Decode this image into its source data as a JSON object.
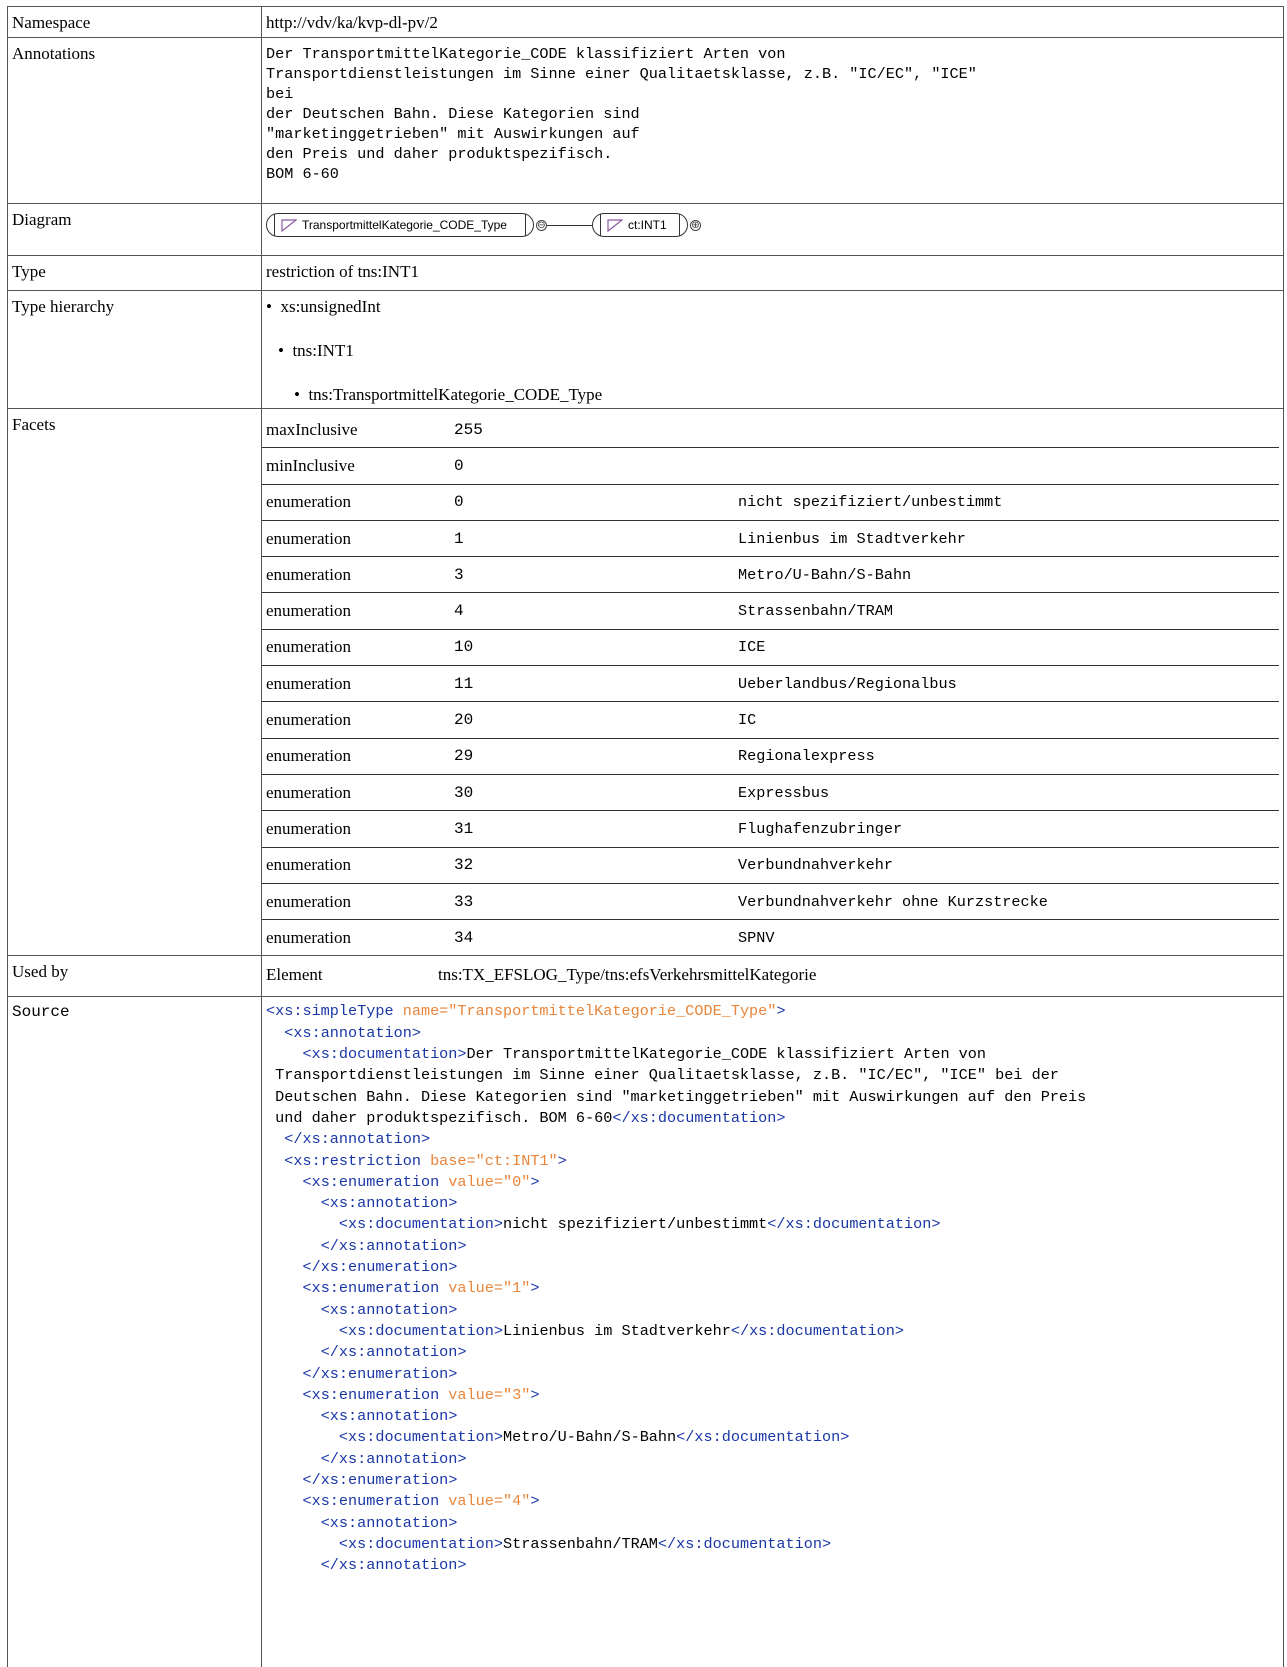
{
  "namespace": {
    "label": "Namespace",
    "value": "http://vdv/ka/kvp-dl-pv/2"
  },
  "annotations": {
    "label": "Annotations",
    "text": "Der TransportmittelKategorie_CODE klassifiziert Arten von\nTransportdienstleistungen im Sinne einer Qualitaetsklasse, z.B. \"IC/EC\", \"ICE\"\nbei\nder Deutschen Bahn. Diese Kategorien sind\n\"marketinggetrieben\" mit Auswirkungen auf\nden Preis und daher produktspezifisch.\nBOM 6-60"
  },
  "diagram": {
    "label": "Diagram",
    "node1": "TransportmittelKategorie_CODE_Type",
    "node2": "ct:INT1",
    "collapse_symbol": "⊖",
    "expand_symbol": "⊕"
  },
  "type": {
    "label": "Type",
    "value": "restriction of tns:INT1"
  },
  "type_hierarchy": {
    "label": "Type hierarchy",
    "bullet": "•",
    "items": [
      "xs:unsignedInt",
      "tns:INT1",
      "tns:TransportmittelKategorie_CODE_Type"
    ]
  },
  "facets": {
    "label": "Facets",
    "rows": [
      {
        "name": "maxInclusive",
        "value": "255",
        "doc": ""
      },
      {
        "name": "minInclusive",
        "value": "0",
        "doc": ""
      },
      {
        "name": "enumeration",
        "value": "0",
        "doc": "nicht spezifiziert/unbestimmt"
      },
      {
        "name": "enumeration",
        "value": "1",
        "doc": "Linienbus im Stadtverkehr"
      },
      {
        "name": "enumeration",
        "value": "3",
        "doc": "Metro/U-Bahn/S-Bahn"
      },
      {
        "name": "enumeration",
        "value": "4",
        "doc": "Strassenbahn/TRAM"
      },
      {
        "name": "enumeration",
        "value": "10",
        "doc": "ICE"
      },
      {
        "name": "enumeration",
        "value": "11",
        "doc": "Ueberlandbus/Regionalbus"
      },
      {
        "name": "enumeration",
        "value": "20",
        "doc": "IC"
      },
      {
        "name": "enumeration",
        "value": "29",
        "doc": "Regionalexpress"
      },
      {
        "name": "enumeration",
        "value": "30",
        "doc": "Expressbus"
      },
      {
        "name": "enumeration",
        "value": "31",
        "doc": "Flughafenzubringer"
      },
      {
        "name": "enumeration",
        "value": "32",
        "doc": "Verbundnahverkehr"
      },
      {
        "name": "enumeration",
        "value": "33",
        "doc": "Verbundnahverkehr ohne Kurzstrecke"
      },
      {
        "name": "enumeration",
        "value": "34",
        "doc": "SPNV"
      }
    ]
  },
  "used_by": {
    "label": "Used by",
    "kind": "Element",
    "value": "tns:TX_EFSLOG_Type/tns:efsVerkehrsmittelKategorie"
  },
  "source": {
    "label": "Source",
    "colors": {
      "tag": "#1a37a6",
      "attribute": "#e8853a",
      "text": "#000000"
    },
    "lines": [
      [
        [
          "t",
          "<xs:simpleType"
        ],
        [
          "a",
          " name="
        ],
        [
          "s",
          "\"TransportmittelKategorie_CODE_Type\""
        ],
        [
          "t",
          ">"
        ]
      ],
      [
        [
          "x",
          "  "
        ],
        [
          "t",
          "<xs:annotation>"
        ]
      ],
      [
        [
          "x",
          "    "
        ],
        [
          "t",
          "<xs:documentation>"
        ],
        [
          "x",
          "Der TransportmittelKategorie_CODE klassifiziert Arten von"
        ]
      ],
      [
        [
          "x",
          " Transportdienstleistungen im Sinne einer Qualitaetsklasse, z.B. \"IC/EC\", \"ICE\" bei der"
        ]
      ],
      [
        [
          "x",
          " Deutschen Bahn. Diese Kategorien sind \"marketinggetrieben\" mit Auswirkungen auf den Preis"
        ]
      ],
      [
        [
          "x",
          " und daher produktspezifisch. BOM 6-60"
        ],
        [
          "t",
          "</xs:documentation>"
        ]
      ],
      [
        [
          "x",
          "  "
        ],
        [
          "t",
          "</xs:annotation>"
        ]
      ],
      [
        [
          "x",
          "  "
        ],
        [
          "t",
          "<xs:restriction"
        ],
        [
          "a",
          " base="
        ],
        [
          "s",
          "\"ct:INT1\""
        ],
        [
          "t",
          ">"
        ]
      ],
      [
        [
          "x",
          "    "
        ],
        [
          "t",
          "<xs:enumeration"
        ],
        [
          "a",
          " value="
        ],
        [
          "s",
          "\"0\""
        ],
        [
          "t",
          ">"
        ]
      ],
      [
        [
          "x",
          "      "
        ],
        [
          "t",
          "<xs:annotation>"
        ]
      ],
      [
        [
          "x",
          "        "
        ],
        [
          "t",
          "<xs:documentation>"
        ],
        [
          "x",
          "nicht spezifiziert/unbestimmt"
        ],
        [
          "t",
          "</xs:documentation>"
        ]
      ],
      [
        [
          "x",
          "      "
        ],
        [
          "t",
          "</xs:annotation>"
        ]
      ],
      [
        [
          "x",
          "    "
        ],
        [
          "t",
          "</xs:enumeration>"
        ]
      ],
      [
        [
          "x",
          "    "
        ],
        [
          "t",
          "<xs:enumeration"
        ],
        [
          "a",
          " value="
        ],
        [
          "s",
          "\"1\""
        ],
        [
          "t",
          ">"
        ]
      ],
      [
        [
          "x",
          "      "
        ],
        [
          "t",
          "<xs:annotation>"
        ]
      ],
      [
        [
          "x",
          "        "
        ],
        [
          "t",
          "<xs:documentation>"
        ],
        [
          "x",
          "Linienbus im Stadtverkehr"
        ],
        [
          "t",
          "</xs:documentation>"
        ]
      ],
      [
        [
          "x",
          "      "
        ],
        [
          "t",
          "</xs:annotation>"
        ]
      ],
      [
        [
          "x",
          "    "
        ],
        [
          "t",
          "</xs:enumeration>"
        ]
      ],
      [
        [
          "x",
          "    "
        ],
        [
          "t",
          "<xs:enumeration"
        ],
        [
          "a",
          " value="
        ],
        [
          "s",
          "\"3\""
        ],
        [
          "t",
          ">"
        ]
      ],
      [
        [
          "x",
          "      "
        ],
        [
          "t",
          "<xs:annotation>"
        ]
      ],
      [
        [
          "x",
          "        "
        ],
        [
          "t",
          "<xs:documentation>"
        ],
        [
          "x",
          "Metro/U-Bahn/S-Bahn"
        ],
        [
          "t",
          "</xs:documentation>"
        ]
      ],
      [
        [
          "x",
          "      "
        ],
        [
          "t",
          "</xs:annotation>"
        ]
      ],
      [
        [
          "x",
          "    "
        ],
        [
          "t",
          "</xs:enumeration>"
        ]
      ],
      [
        [
          "x",
          "    "
        ],
        [
          "t",
          "<xs:enumeration"
        ],
        [
          "a",
          " value="
        ],
        [
          "s",
          "\"4\""
        ],
        [
          "t",
          ">"
        ]
      ],
      [
        [
          "x",
          "      "
        ],
        [
          "t",
          "<xs:annotation>"
        ]
      ],
      [
        [
          "x",
          "        "
        ],
        [
          "t",
          "<xs:documentation>"
        ],
        [
          "x",
          "Strassenbahn/TRAM"
        ],
        [
          "t",
          "</xs:documentation>"
        ]
      ],
      [
        [
          "x",
          "      "
        ],
        [
          "t",
          "</xs:annotation>"
        ]
      ]
    ]
  }
}
